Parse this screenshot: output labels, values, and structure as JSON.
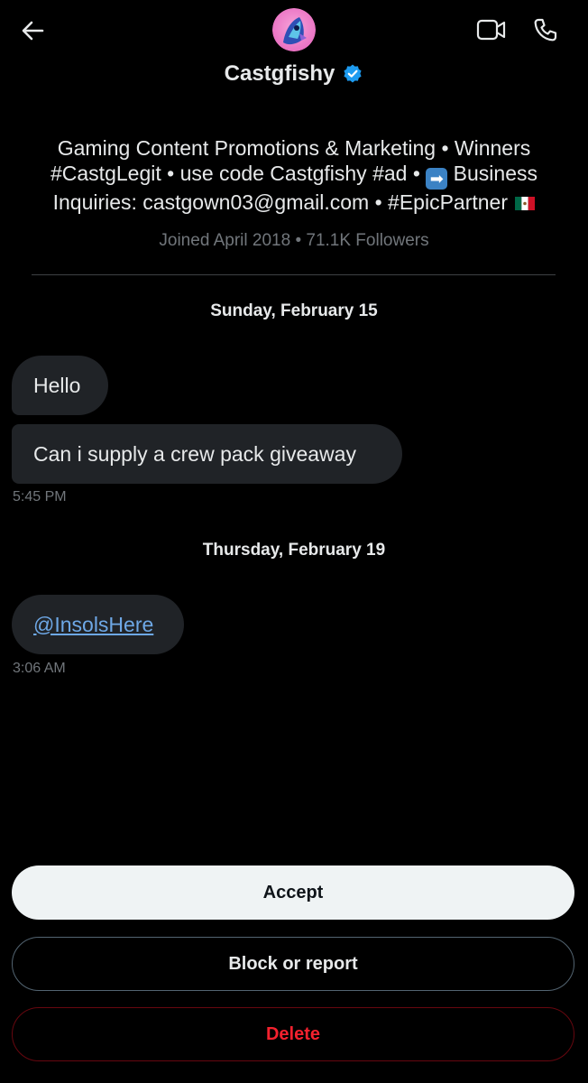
{
  "header": {
    "back_icon": "arrow-left-icon",
    "video_icon": "video-call-icon",
    "phone_icon": "phone-call-icon",
    "avatar_icon": "profile-avatar",
    "verified_icon": "verified-badge-icon"
  },
  "profile": {
    "name": "Castgfishy",
    "bio_line_1": "Gaming Content Promotions & Marketing • Winners",
    "bio_line_2_a": "#CastgLegit • use code Castgfishy #ad • ",
    "bio_line_2_b": " Business",
    "bio_line_3": "Inquiries: castgown03@gmail.com • #EpicPartner",
    "bio_emoji_arrow": "➡",
    "meta": "Joined April 2018 • 71.1K Followers"
  },
  "conversation": {
    "groups": [
      {
        "date": "Sunday, February 15",
        "messages": [
          "Hello",
          "Can i supply a crew pack giveaway"
        ],
        "time": "5:45 PM"
      },
      {
        "date": "Thursday, February 19",
        "messages": [
          "@InsolsHere"
        ],
        "time": "3:06 AM"
      }
    ]
  },
  "actions": {
    "accept": "Accept",
    "block_or_report": "Block or report",
    "delete": "Delete"
  },
  "colors": {
    "background": "#000000",
    "bubble": "#202327",
    "accent_blue": "#1d9bf0",
    "link": "#6ea8e6",
    "danger": "#f4212e",
    "muted_text": "#71767b"
  }
}
